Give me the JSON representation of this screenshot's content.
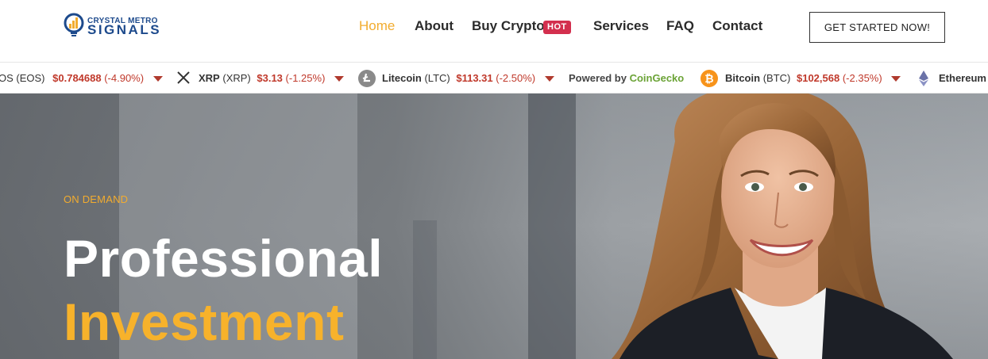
{
  "logo": {
    "line1": "CRYSTAL METRO",
    "line2": "SIGNALS"
  },
  "nav": {
    "items": [
      {
        "label": "Home",
        "active": true
      },
      {
        "label": "About"
      },
      {
        "label": "Buy Crypto",
        "badge": "HOT"
      },
      {
        "label": "Services"
      },
      {
        "label": "FAQ"
      },
      {
        "label": "Contact"
      }
    ]
  },
  "cta": {
    "label": "GET STARTED NOW!"
  },
  "ticker": {
    "items": [
      {
        "name": "",
        "symbol": "OS (EOS)",
        "price": "$0.784688",
        "change": "(-4.90%)",
        "icon": "eos-icon"
      },
      {
        "name": "XRP",
        "symbol": "(XRP)",
        "price": "$3.13",
        "change": "(-1.25%)",
        "icon": "xrp-icon"
      },
      {
        "name": "Litecoin",
        "symbol": "(LTC)",
        "price": "$113.31",
        "change": "(-2.50%)",
        "icon": "litecoin-icon"
      },
      {
        "name": "Bitcoin",
        "symbol": "(BTC)",
        "price": "$102,568",
        "change": "(-2.35%)",
        "icon": "bitcoin-icon"
      },
      {
        "name": "Ethereum",
        "symbol": "",
        "price": "",
        "change": "",
        "icon": "ethereum-icon"
      }
    ],
    "powered_prefix": "Powered by",
    "powered_brand": "CoinGecko"
  },
  "hero": {
    "eyebrow": "ON DEMAND",
    "title_line1": "Professional",
    "title_line2": "Investment"
  },
  "colors": {
    "accent": "#f2ac2f",
    "negative": "#c0392b",
    "hot": "#d32f4e",
    "brand": "#1d4a8c"
  }
}
